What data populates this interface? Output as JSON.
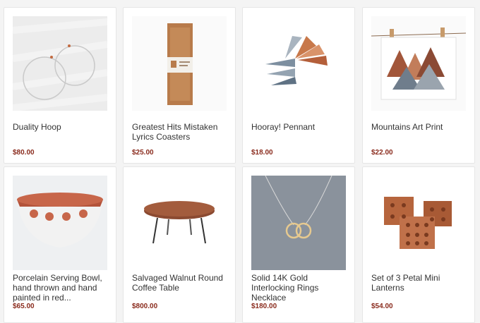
{
  "products": [
    {
      "name": "Duality Hoop",
      "price": "$80.00",
      "icon": "hoop-earrings-image"
    },
    {
      "name": "Greatest Hits Mistaken Lyrics Coasters",
      "price": "$25.00",
      "icon": "coasters-box-image"
    },
    {
      "name": "Hooray! Pennant",
      "price": "$18.00",
      "icon": "pennant-fan-image"
    },
    {
      "name": "Mountains Art Print",
      "price": "$22.00",
      "icon": "mountains-print-image"
    },
    {
      "name": "Porcelain Serving Bowl, hand thrown and hand painted in red...",
      "price": "$65.00",
      "icon": "serving-bowl-image"
    },
    {
      "name": "Salvaged Walnut Round Coffee Table",
      "price": "$800.00",
      "icon": "coffee-table-image"
    },
    {
      "name": "Solid 14K Gold Interlocking Rings Necklace",
      "price": "$180.00",
      "icon": "rings-necklace-image"
    },
    {
      "name": "Set of 3 Petal Mini Lanterns",
      "price": "$54.00",
      "icon": "lanterns-image"
    }
  ]
}
